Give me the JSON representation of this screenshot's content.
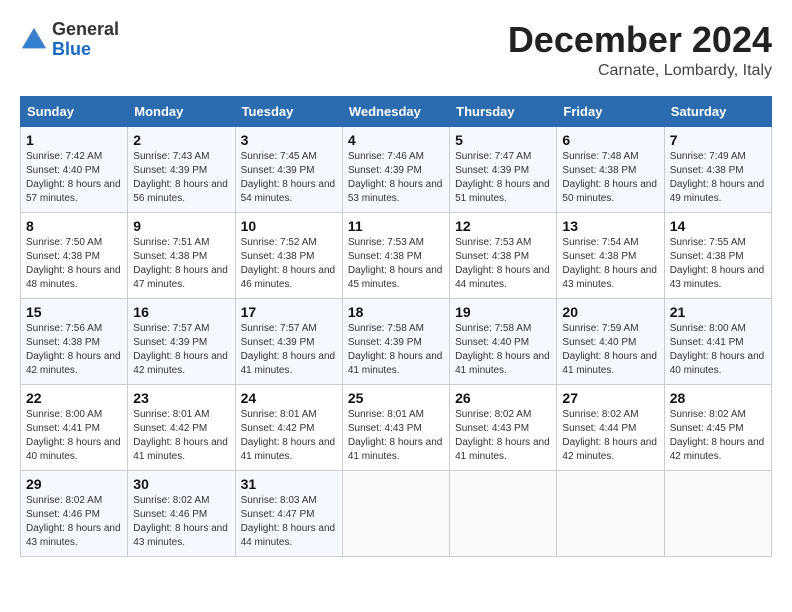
{
  "header": {
    "logo_line1": "General",
    "logo_line2": "Blue",
    "month_title": "December 2024",
    "location": "Carnate, Lombardy, Italy"
  },
  "days_of_week": [
    "Sunday",
    "Monday",
    "Tuesday",
    "Wednesday",
    "Thursday",
    "Friday",
    "Saturday"
  ],
  "weeks": [
    [
      {
        "day": "1",
        "sunrise": "Sunrise: 7:42 AM",
        "sunset": "Sunset: 4:40 PM",
        "daylight": "Daylight: 8 hours and 57 minutes."
      },
      {
        "day": "2",
        "sunrise": "Sunrise: 7:43 AM",
        "sunset": "Sunset: 4:39 PM",
        "daylight": "Daylight: 8 hours and 56 minutes."
      },
      {
        "day": "3",
        "sunrise": "Sunrise: 7:45 AM",
        "sunset": "Sunset: 4:39 PM",
        "daylight": "Daylight: 8 hours and 54 minutes."
      },
      {
        "day": "4",
        "sunrise": "Sunrise: 7:46 AM",
        "sunset": "Sunset: 4:39 PM",
        "daylight": "Daylight: 8 hours and 53 minutes."
      },
      {
        "day": "5",
        "sunrise": "Sunrise: 7:47 AM",
        "sunset": "Sunset: 4:39 PM",
        "daylight": "Daylight: 8 hours and 51 minutes."
      },
      {
        "day": "6",
        "sunrise": "Sunrise: 7:48 AM",
        "sunset": "Sunset: 4:38 PM",
        "daylight": "Daylight: 8 hours and 50 minutes."
      },
      {
        "day": "7",
        "sunrise": "Sunrise: 7:49 AM",
        "sunset": "Sunset: 4:38 PM",
        "daylight": "Daylight: 8 hours and 49 minutes."
      }
    ],
    [
      {
        "day": "8",
        "sunrise": "Sunrise: 7:50 AM",
        "sunset": "Sunset: 4:38 PM",
        "daylight": "Daylight: 8 hours and 48 minutes."
      },
      {
        "day": "9",
        "sunrise": "Sunrise: 7:51 AM",
        "sunset": "Sunset: 4:38 PM",
        "daylight": "Daylight: 8 hours and 47 minutes."
      },
      {
        "day": "10",
        "sunrise": "Sunrise: 7:52 AM",
        "sunset": "Sunset: 4:38 PM",
        "daylight": "Daylight: 8 hours and 46 minutes."
      },
      {
        "day": "11",
        "sunrise": "Sunrise: 7:53 AM",
        "sunset": "Sunset: 4:38 PM",
        "daylight": "Daylight: 8 hours and 45 minutes."
      },
      {
        "day": "12",
        "sunrise": "Sunrise: 7:53 AM",
        "sunset": "Sunset: 4:38 PM",
        "daylight": "Daylight: 8 hours and 44 minutes."
      },
      {
        "day": "13",
        "sunrise": "Sunrise: 7:54 AM",
        "sunset": "Sunset: 4:38 PM",
        "daylight": "Daylight: 8 hours and 43 minutes."
      },
      {
        "day": "14",
        "sunrise": "Sunrise: 7:55 AM",
        "sunset": "Sunset: 4:38 PM",
        "daylight": "Daylight: 8 hours and 43 minutes."
      }
    ],
    [
      {
        "day": "15",
        "sunrise": "Sunrise: 7:56 AM",
        "sunset": "Sunset: 4:38 PM",
        "daylight": "Daylight: 8 hours and 42 minutes."
      },
      {
        "day": "16",
        "sunrise": "Sunrise: 7:57 AM",
        "sunset": "Sunset: 4:39 PM",
        "daylight": "Daylight: 8 hours and 42 minutes."
      },
      {
        "day": "17",
        "sunrise": "Sunrise: 7:57 AM",
        "sunset": "Sunset: 4:39 PM",
        "daylight": "Daylight: 8 hours and 41 minutes."
      },
      {
        "day": "18",
        "sunrise": "Sunrise: 7:58 AM",
        "sunset": "Sunset: 4:39 PM",
        "daylight": "Daylight: 8 hours and 41 minutes."
      },
      {
        "day": "19",
        "sunrise": "Sunrise: 7:58 AM",
        "sunset": "Sunset: 4:40 PM",
        "daylight": "Daylight: 8 hours and 41 minutes."
      },
      {
        "day": "20",
        "sunrise": "Sunrise: 7:59 AM",
        "sunset": "Sunset: 4:40 PM",
        "daylight": "Daylight: 8 hours and 41 minutes."
      },
      {
        "day": "21",
        "sunrise": "Sunrise: 8:00 AM",
        "sunset": "Sunset: 4:41 PM",
        "daylight": "Daylight: 8 hours and 40 minutes."
      }
    ],
    [
      {
        "day": "22",
        "sunrise": "Sunrise: 8:00 AM",
        "sunset": "Sunset: 4:41 PM",
        "daylight": "Daylight: 8 hours and 40 minutes."
      },
      {
        "day": "23",
        "sunrise": "Sunrise: 8:01 AM",
        "sunset": "Sunset: 4:42 PM",
        "daylight": "Daylight: 8 hours and 41 minutes."
      },
      {
        "day": "24",
        "sunrise": "Sunrise: 8:01 AM",
        "sunset": "Sunset: 4:42 PM",
        "daylight": "Daylight: 8 hours and 41 minutes."
      },
      {
        "day": "25",
        "sunrise": "Sunrise: 8:01 AM",
        "sunset": "Sunset: 4:43 PM",
        "daylight": "Daylight: 8 hours and 41 minutes."
      },
      {
        "day": "26",
        "sunrise": "Sunrise: 8:02 AM",
        "sunset": "Sunset: 4:43 PM",
        "daylight": "Daylight: 8 hours and 41 minutes."
      },
      {
        "day": "27",
        "sunrise": "Sunrise: 8:02 AM",
        "sunset": "Sunset: 4:44 PM",
        "daylight": "Daylight: 8 hours and 42 minutes."
      },
      {
        "day": "28",
        "sunrise": "Sunrise: 8:02 AM",
        "sunset": "Sunset: 4:45 PM",
        "daylight": "Daylight: 8 hours and 42 minutes."
      }
    ],
    [
      {
        "day": "29",
        "sunrise": "Sunrise: 8:02 AM",
        "sunset": "Sunset: 4:46 PM",
        "daylight": "Daylight: 8 hours and 43 minutes."
      },
      {
        "day": "30",
        "sunrise": "Sunrise: 8:02 AM",
        "sunset": "Sunset: 4:46 PM",
        "daylight": "Daylight: 8 hours and 43 minutes."
      },
      {
        "day": "31",
        "sunrise": "Sunrise: 8:03 AM",
        "sunset": "Sunset: 4:47 PM",
        "daylight": "Daylight: 8 hours and 44 minutes."
      },
      null,
      null,
      null,
      null
    ]
  ]
}
